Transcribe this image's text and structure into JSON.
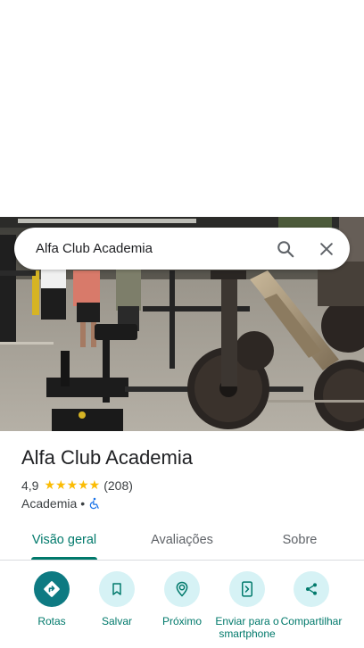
{
  "search": {
    "query": "Alfa Club Academia"
  },
  "place": {
    "name": "Alfa Club Academia",
    "rating": "4,9",
    "stars": "★★★★★",
    "review_count": "(208)",
    "category": "Academia",
    "separator": "•"
  },
  "tabs": [
    {
      "label": "Visão geral",
      "active": true
    },
    {
      "label": "Avaliações",
      "active": false
    },
    {
      "label": "Sobre",
      "active": false
    }
  ],
  "actions": [
    {
      "label": "Rotas",
      "icon": "directions-icon"
    },
    {
      "label": "Salvar",
      "icon": "bookmark-icon"
    },
    {
      "label": "Próximo",
      "icon": "nearby-icon"
    },
    {
      "label": "Enviar para o smartphone",
      "icon": "send-to-phone-icon"
    },
    {
      "label": "Compartilhar",
      "icon": "share-icon"
    }
  ],
  "colors": {
    "accent": "#00796b",
    "primary_action": "#0e7a82",
    "action_bg": "#d6f2f5",
    "star": "#fbbc04"
  }
}
